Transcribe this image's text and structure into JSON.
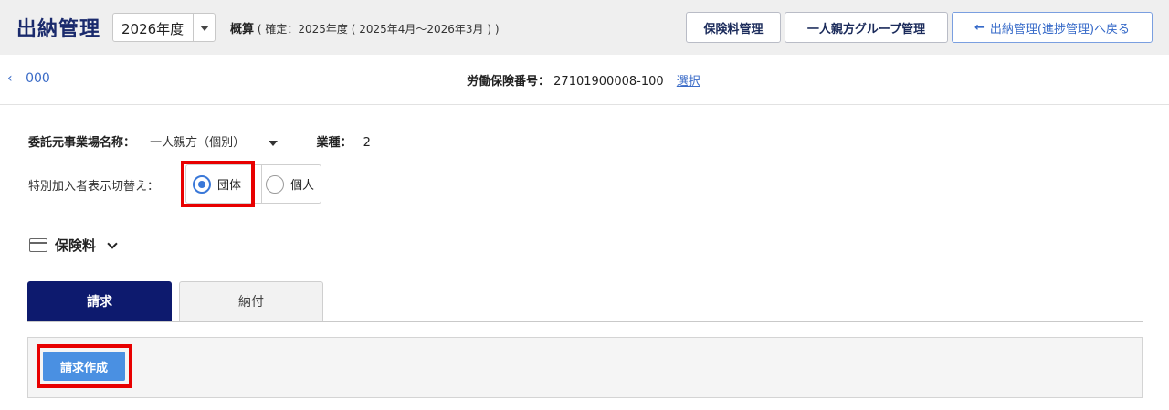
{
  "header": {
    "title": "出納管理",
    "year_select": "2026年度",
    "summary_label": "概算",
    "summary_detail": "( 確定：2025年度 ( 2025年4月～2026年3月 ) )",
    "buttons": {
      "premium": "保険料管理",
      "group": "一人親方グループ管理",
      "back": "出納管理(進捗管理)へ戻る"
    }
  },
  "subheader": {
    "back_link": "000",
    "insurance_no_label": "労働保険番号：",
    "insurance_no": "27101900008-100",
    "select_link": "選択"
  },
  "office": {
    "name_label": "委託元事業場名称：",
    "name_value": "一人親方（個別）",
    "industry_label": "業種：",
    "industry_value": "2"
  },
  "toggle": {
    "label": "特別加入者表示切替え：",
    "options": [
      "団体",
      "個人"
    ],
    "selected": "団体"
  },
  "section": {
    "title": "保険料"
  },
  "tabs": {
    "active": "請求",
    "inactive": "納付"
  },
  "panel": {
    "create_button": "請求作成"
  },
  "colors": {
    "title": "#1a2a6c",
    "tab_active": "#0d1a6e",
    "primary_button": "#4a90e2",
    "highlight": "#e80000",
    "link": "#3a6bc7"
  }
}
